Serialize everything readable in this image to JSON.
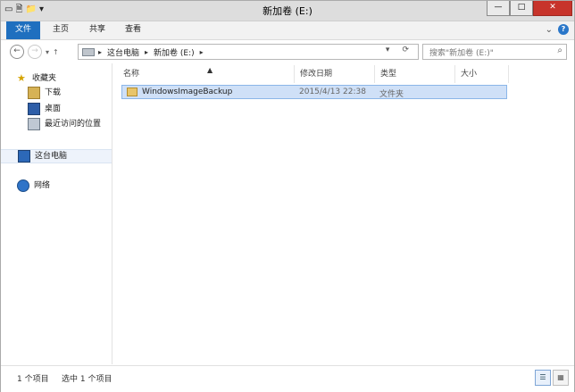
{
  "window": {
    "title": "新加卷 (E:)"
  },
  "ribbon": {
    "tabs": [
      {
        "label": "文件"
      },
      {
        "label": "主页"
      },
      {
        "label": "共享"
      },
      {
        "label": "查看"
      }
    ]
  },
  "address": {
    "breadcrumb": [
      "这台电脑",
      "新加卷 (E:)"
    ]
  },
  "search": {
    "placeholder": "搜索\"新加卷 (E:)\""
  },
  "nav": {
    "favorites": "收藏夹",
    "downloads": "下载",
    "desktop": "桌面",
    "recent": "最近访问的位置",
    "this_pc": "这台电脑",
    "network": "网络"
  },
  "columns": [
    "名称",
    "修改日期",
    "类型",
    "大小"
  ],
  "files": [
    {
      "name": "WindowsImageBackup",
      "date": "2015/4/13 22:38",
      "type": "文件夹"
    }
  ],
  "status": {
    "count": "1 个项目",
    "selected": "选中 1 个项目"
  },
  "icons": {
    "back": "back-arrow-icon",
    "forward": "forward-arrow-icon",
    "up": "up-arrow-icon",
    "refresh": "refresh-icon",
    "search": "search-icon",
    "help": "help-icon",
    "folder": "folder-icon"
  }
}
